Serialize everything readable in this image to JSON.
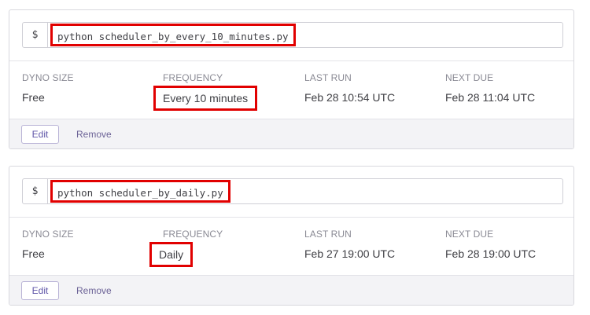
{
  "jobs": [
    {
      "prompt": "$",
      "command": "python scheduler_by_every_10_minutes.py",
      "labels": {
        "dyno_size": "DYNO SIZE",
        "frequency": "FREQUENCY",
        "last_run": "LAST RUN",
        "next_due": "NEXT DUE"
      },
      "dyno_size": "Free",
      "frequency": "Every 10 minutes",
      "last_run": "Feb 28 10:54 UTC",
      "next_due": "Feb 28 11:04 UTC",
      "edit_label": "Edit",
      "remove_label": "Remove"
    },
    {
      "prompt": "$",
      "command": "python scheduler_by_daily.py",
      "labels": {
        "dyno_size": "DYNO SIZE",
        "frequency": "FREQUENCY",
        "last_run": "LAST RUN",
        "next_due": "NEXT DUE"
      },
      "dyno_size": "Free",
      "frequency": "Daily",
      "last_run": "Feb 27 19:00 UTC",
      "next_due": "Feb 28 19:00 UTC",
      "edit_label": "Edit",
      "remove_label": "Remove"
    }
  ],
  "colors": {
    "highlight": "#e10000",
    "accent": "#5f55a8",
    "footer_bg": "#f3f3f6"
  }
}
